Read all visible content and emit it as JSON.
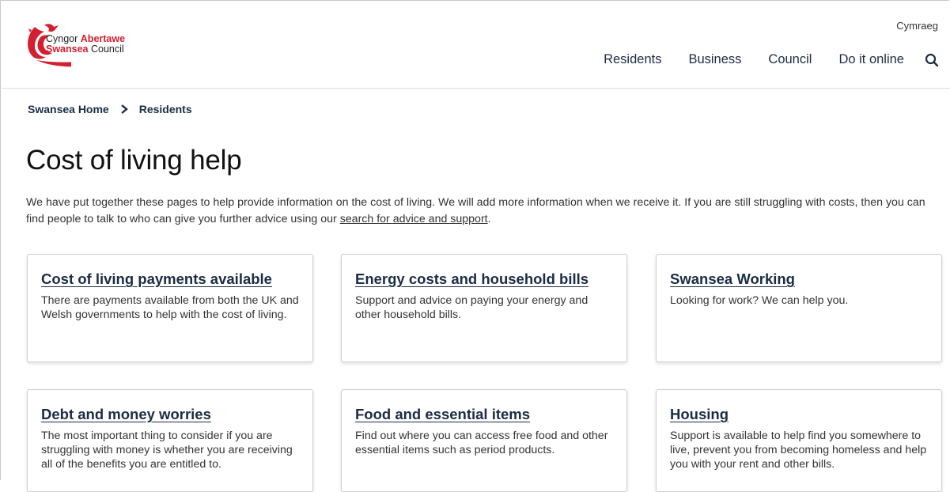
{
  "header": {
    "logo_line1_prefix": "Cyngor ",
    "logo_line1_bold": "Abertawe",
    "logo_line2_bold": "Swansea",
    "logo_line2_suffix": " Council",
    "language_link": "Cymraeg",
    "nav": [
      "Residents",
      "Business",
      "Council",
      "Do it online"
    ]
  },
  "breadcrumb": {
    "home": "Swansea Home",
    "current": "Residents"
  },
  "page": {
    "title": "Cost of living help",
    "intro_text": "We have put together these pages to help provide information on the cost of living. We will add more information when we receive it. If you are still struggling with costs, then you can find people to talk to who can give you further advice using our ",
    "intro_link": "search for advice and support",
    "intro_end": "."
  },
  "cards": [
    {
      "title": "Cost of living payments available",
      "desc": "There are payments available from both the UK and Welsh governments to help with the cost of living."
    },
    {
      "title": "Energy costs and household bills",
      "desc": "Support and advice on paying your energy and other household bills."
    },
    {
      "title": "Swansea Working",
      "desc": "Looking for work? We can help you."
    },
    {
      "title": "Debt and money worries",
      "desc": "The most important thing to consider if you are struggling with money is whether you are receiving all of the benefits you are entitled to."
    },
    {
      "title": "Food and essential items",
      "desc": "Find out where you can access free food and other essential items such as period products."
    },
    {
      "title": "Housing",
      "desc": "Support is available to help find you somewhere to live, prevent you from becoming homeless and help you with your rent and other bills."
    }
  ],
  "colors": {
    "brand_red": "#d31f2f",
    "nav_text": "#1b2c44"
  }
}
